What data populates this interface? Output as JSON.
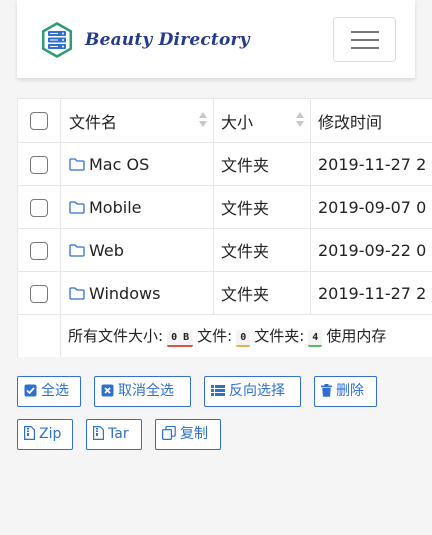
{
  "brand": {
    "name": "Beauty Directory"
  },
  "table": {
    "headers": [
      "文件名",
      "大小",
      "修改时间"
    ],
    "rows": [
      {
        "name": "Mac OS",
        "size": "文件夹",
        "modified": "2019-11-27 2"
      },
      {
        "name": "Mobile",
        "size": "文件夹",
        "modified": "2019-09-07 0"
      },
      {
        "name": "Web",
        "size": "文件夹",
        "modified": "2019-09-22 0"
      },
      {
        "name": "Windows",
        "size": "文件夹",
        "modified": "2019-11-27 2"
      }
    ],
    "footer": {
      "total_size_label": "所有文件大小:",
      "total_size": "0 B",
      "total_size_color": "#e05048",
      "files_label": "文件:",
      "files_count": "0",
      "files_color": "#f0ad4e",
      "folders_label": "文件夹:",
      "folders_count": "4",
      "folders_color": "#5cb85c",
      "memory_label": "使用内存"
    }
  },
  "actions": {
    "select_all": "全选",
    "deselect_all": "取消全选",
    "invert": "反向选择",
    "delete": "删除",
    "zip": "Zip",
    "tar": "Tar",
    "copy": "复制"
  },
  "colors": {
    "accent": "#2f6fd0",
    "brand": "#243a8c"
  }
}
